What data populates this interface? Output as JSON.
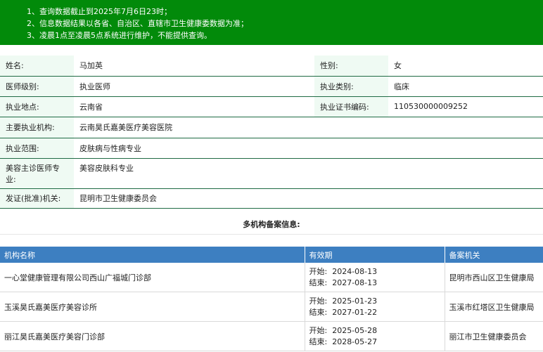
{
  "notice": [
    "1、查询数据截止到2025年7月6日23时；",
    "2、信息数据结果以各省、自治区、直辖市卫生健康委数据为准；",
    "3、凌晨1点至凌晨5点系统进行维护，不能提供查询。"
  ],
  "info": {
    "name_label": "姓名:",
    "name_value": "马加英",
    "gender_label": "性别:",
    "gender_value": "女",
    "level_label": "医师级别:",
    "level_value": "执业医师",
    "category_label": "执业类别:",
    "category_value": "临床",
    "location_label": "执业地点:",
    "location_value": "云南省",
    "cert_label": "执业证书编码:",
    "cert_value": "110530000009252",
    "org_label": "主要执业机构:",
    "org_value": "云南昊氏嘉美医疗美容医院",
    "scope_label": "执业范围:",
    "scope_value": "皮肤病与性病专业",
    "cosmetic_label": "美容主诊医师专业:",
    "cosmetic_value": "美容皮肤科专业",
    "issuer_label": "发证(批准)机关:",
    "issuer_value": "昆明市卫生健康委员会"
  },
  "multi": {
    "title": "多机构备案信息:",
    "headers": [
      "机构名称",
      "有效期",
      "备案机关"
    ],
    "start_label": "开始:",
    "end_label": "结束:",
    "rows": [
      {
        "name": "一心堂健康管理有限公司西山广福城门诊部",
        "start": "2024-08-13",
        "end": "2027-08-13",
        "authority": "昆明市西山区卫生健康局"
      },
      {
        "name": "玉溪昊氏嘉美医疗美容诊所",
        "start": "2025-01-23",
        "end": "2027-01-22",
        "authority": "玉溪市红塔区卫生健康局"
      },
      {
        "name": "丽江昊氏嘉美医疗美容门诊部",
        "start": "2025-05-28",
        "end": "2028-05-27",
        "authority": "丽江市卫生健康委员会"
      }
    ]
  }
}
